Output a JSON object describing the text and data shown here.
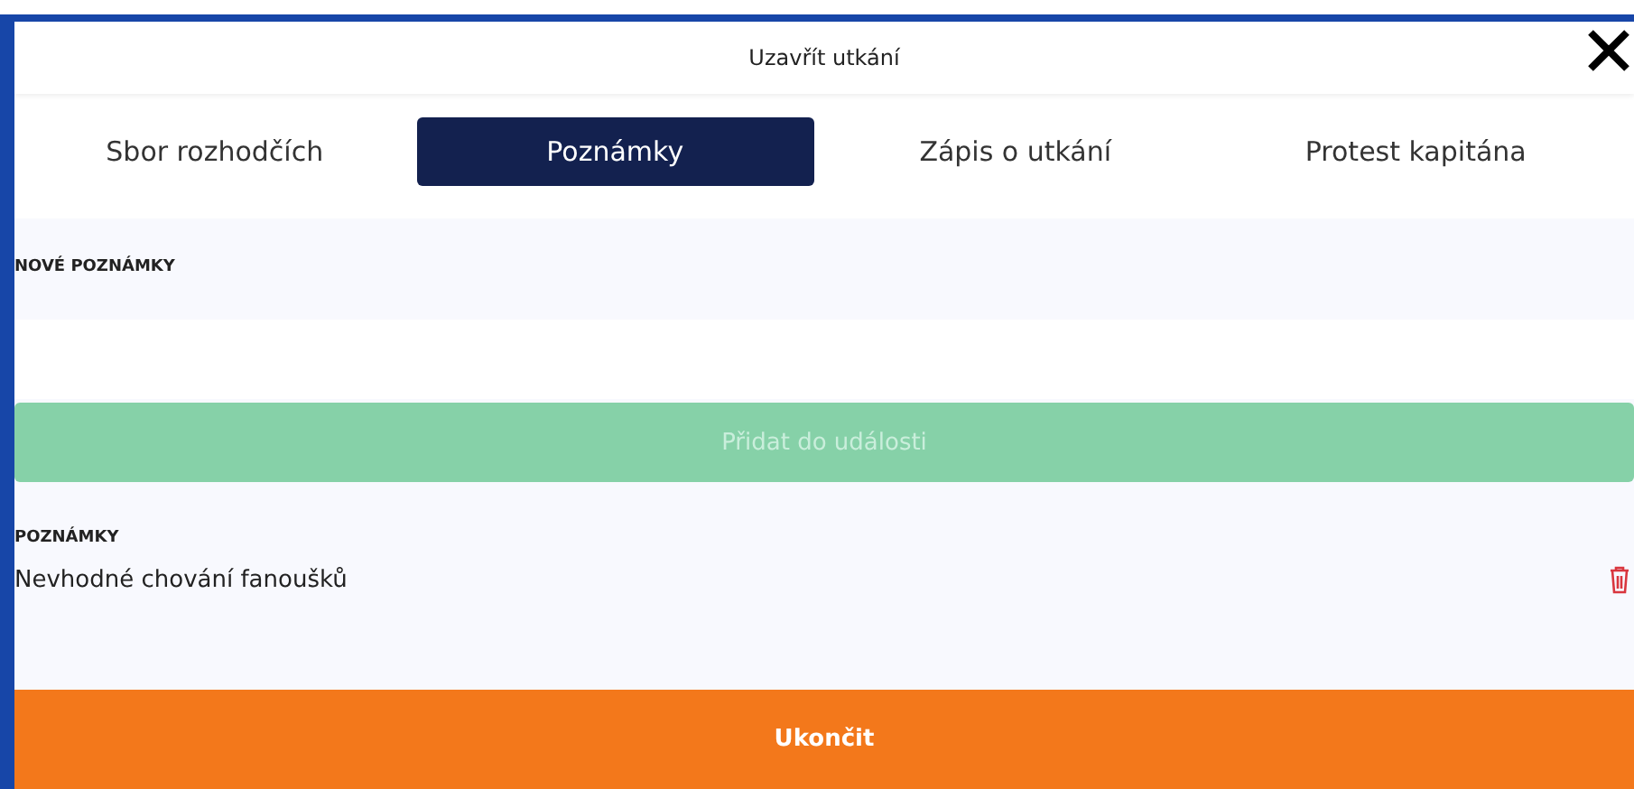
{
  "dialog": {
    "title": "Uzavřít utkání"
  },
  "tabs": [
    {
      "label": "Sbor rozhodčích",
      "selected": false
    },
    {
      "label": "Poznámky",
      "selected": true
    },
    {
      "label": "Zápis o utkání",
      "selected": false
    },
    {
      "label": "Protest kapitána",
      "selected": false
    }
  ],
  "new_notes": {
    "label": "NOVÉ POZNÁMKY",
    "add_button": {
      "label": "Přidat do události",
      "disabled": true
    }
  },
  "notes": {
    "label": "POZNÁMKY",
    "items": [
      {
        "text": "Nevhodné chování fanoušků"
      }
    ]
  },
  "finish_button": "Ukončit"
}
